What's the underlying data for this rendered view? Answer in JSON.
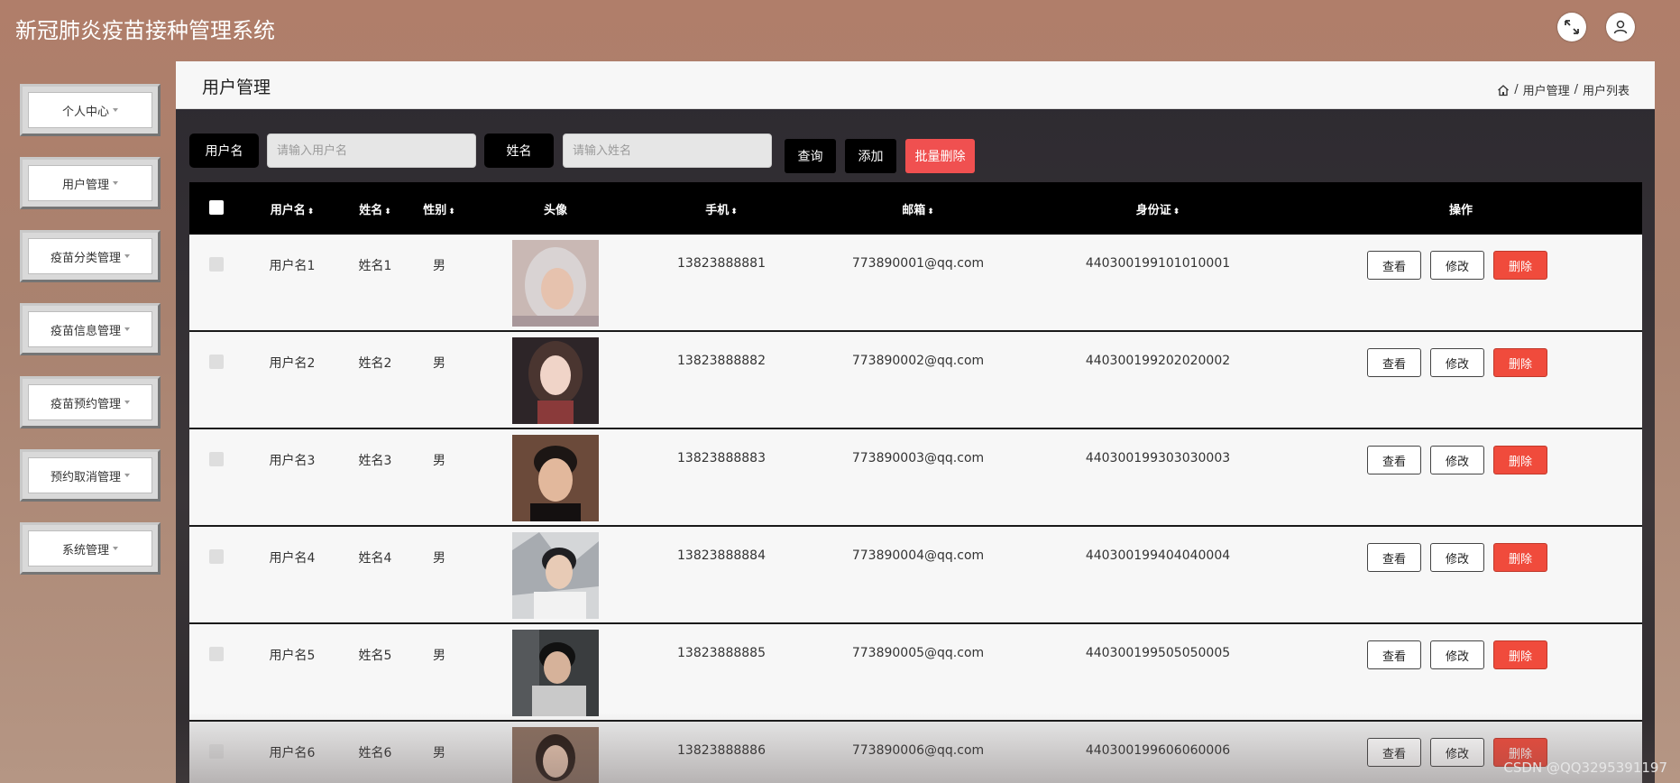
{
  "app": {
    "title": "新冠肺炎疫苗接种管理系统"
  },
  "header": {
    "fullscreen_icon": "fullscreen-icon",
    "user_icon": "user-icon"
  },
  "sidebar": {
    "items": [
      {
        "label": "个人中心"
      },
      {
        "label": "用户管理"
      },
      {
        "label": "疫苗分类管理"
      },
      {
        "label": "疫苗信息管理"
      },
      {
        "label": "疫苗预约管理"
      },
      {
        "label": "预约取消管理"
      },
      {
        "label": "系统管理"
      }
    ]
  },
  "page": {
    "title": "用户管理",
    "breadcrumb": {
      "home_icon": "home-icon",
      "sep": "/",
      "items": [
        "用户管理",
        "用户列表"
      ]
    }
  },
  "search": {
    "username_label": "用户名",
    "username_placeholder": "请输入用户名",
    "name_label": "姓名",
    "name_placeholder": "请输入姓名",
    "query_button": "查询",
    "add_button": "添加",
    "batch_delete_button": "批量删除"
  },
  "table": {
    "columns": {
      "username": "用户名",
      "name": "姓名",
      "gender": "性别",
      "avatar": "头像",
      "phone": "手机",
      "email": "邮箱",
      "idcard": "身份证",
      "actions": "操作"
    },
    "actions": {
      "view": "查看",
      "edit": "修改",
      "delete": "删除"
    },
    "rows": [
      {
        "username": "用户名1",
        "name": "姓名1",
        "gender": "男",
        "phone": "13823888881",
        "email": "773890001@qq.com",
        "idcard": "440300199101010001"
      },
      {
        "username": "用户名2",
        "name": "姓名2",
        "gender": "男",
        "phone": "13823888882",
        "email": "773890002@qq.com",
        "idcard": "440300199202020002"
      },
      {
        "username": "用户名3",
        "name": "姓名3",
        "gender": "男",
        "phone": "13823888883",
        "email": "773890003@qq.com",
        "idcard": "440300199303030003"
      },
      {
        "username": "用户名4",
        "name": "姓名4",
        "gender": "男",
        "phone": "13823888884",
        "email": "773890004@qq.com",
        "idcard": "440300199404040004"
      },
      {
        "username": "用户名5",
        "name": "姓名5",
        "gender": "男",
        "phone": "13823888885",
        "email": "773890005@qq.com",
        "idcard": "440300199505050005"
      },
      {
        "username": "用户名6",
        "name": "姓名6",
        "gender": "男",
        "phone": "13823888886",
        "email": "773890006@qq.com",
        "idcard": "440300199606060006"
      }
    ]
  },
  "watermark": "CSDN @QQ3295391197",
  "colors": {
    "header_bg": "#b07e6a",
    "danger": "#f04b3c",
    "dark": "#000000"
  }
}
